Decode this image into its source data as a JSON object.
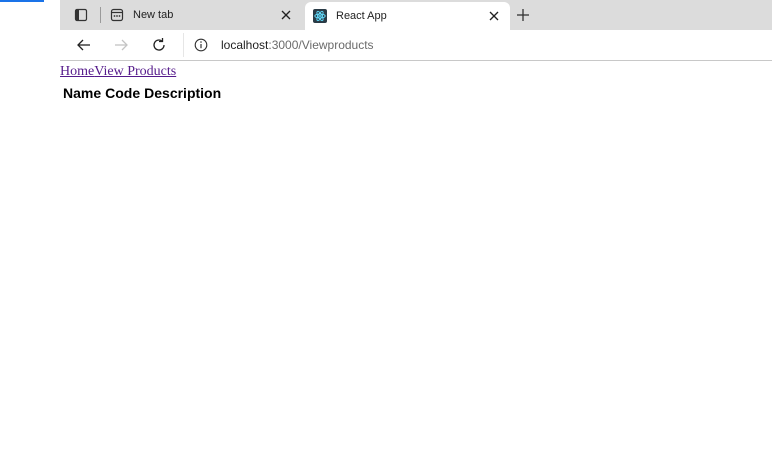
{
  "browser": {
    "tabs": [
      {
        "title": "New tab",
        "icon": "new-tab-page-icon",
        "active": false
      },
      {
        "title": "React App",
        "icon": "react-logo-icon",
        "active": true
      }
    ],
    "address": {
      "host": "localhost",
      "path": ":3000/Viewproducts"
    }
  },
  "page": {
    "nav_links": [
      "Home",
      "View Products"
    ],
    "table_headers": [
      "Name",
      "Code",
      "Description"
    ]
  },
  "colors": {
    "accent": "#1a73e8",
    "visited_link": "#551a8b",
    "react_logo": "#61dafb"
  }
}
